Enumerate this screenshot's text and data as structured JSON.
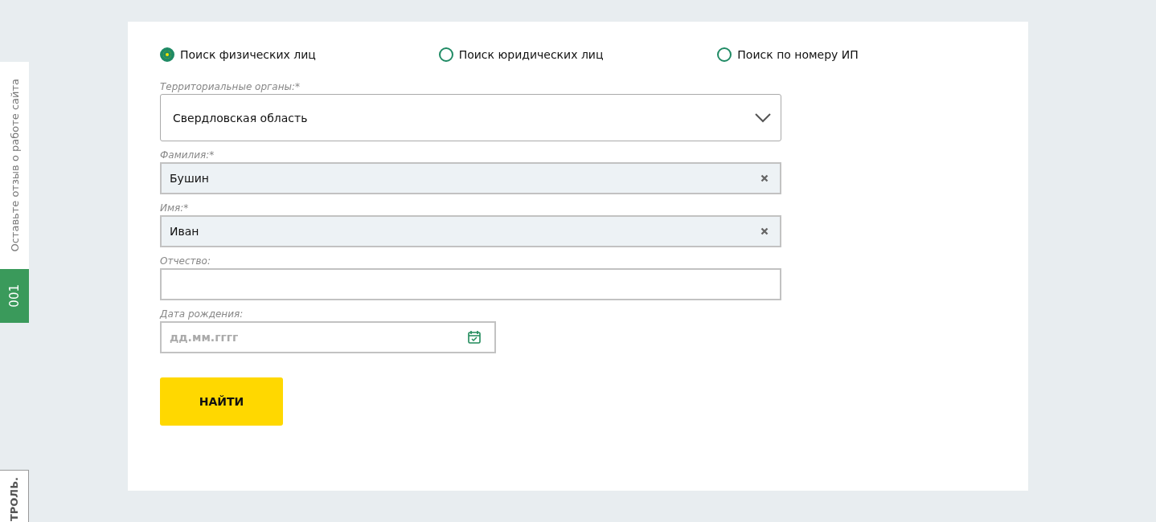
{
  "side_tabs": [
    {
      "label": "Оставьте отзыв о работе сайта",
      "kind": "feedback"
    },
    {
      "label": "001",
      "kind": "badge"
    },
    {
      "label": "ТРОЛЬ.",
      "kind": "cut"
    }
  ],
  "search_modes": [
    {
      "label": "Поиск физических лиц",
      "selected": true
    },
    {
      "label": "Поиск юридических лиц",
      "selected": false
    },
    {
      "label": "Поиск по номеру ИП",
      "selected": false
    }
  ],
  "fields": [
    {
      "kind": "select",
      "label": "Территориальные органы:*",
      "value": "Свердловская область"
    },
    {
      "kind": "text",
      "label": "Фамилия:*",
      "value": "Бушин"
    },
    {
      "kind": "text",
      "label": "Имя:*",
      "value": "Иван"
    },
    {
      "kind": "text",
      "label": "Отчество:"
    },
    {
      "kind": "date",
      "label": "Дата рождения:",
      "placeholder": "дд.мм.гггг"
    }
  ],
  "submit_button": "НАЙТИ"
}
